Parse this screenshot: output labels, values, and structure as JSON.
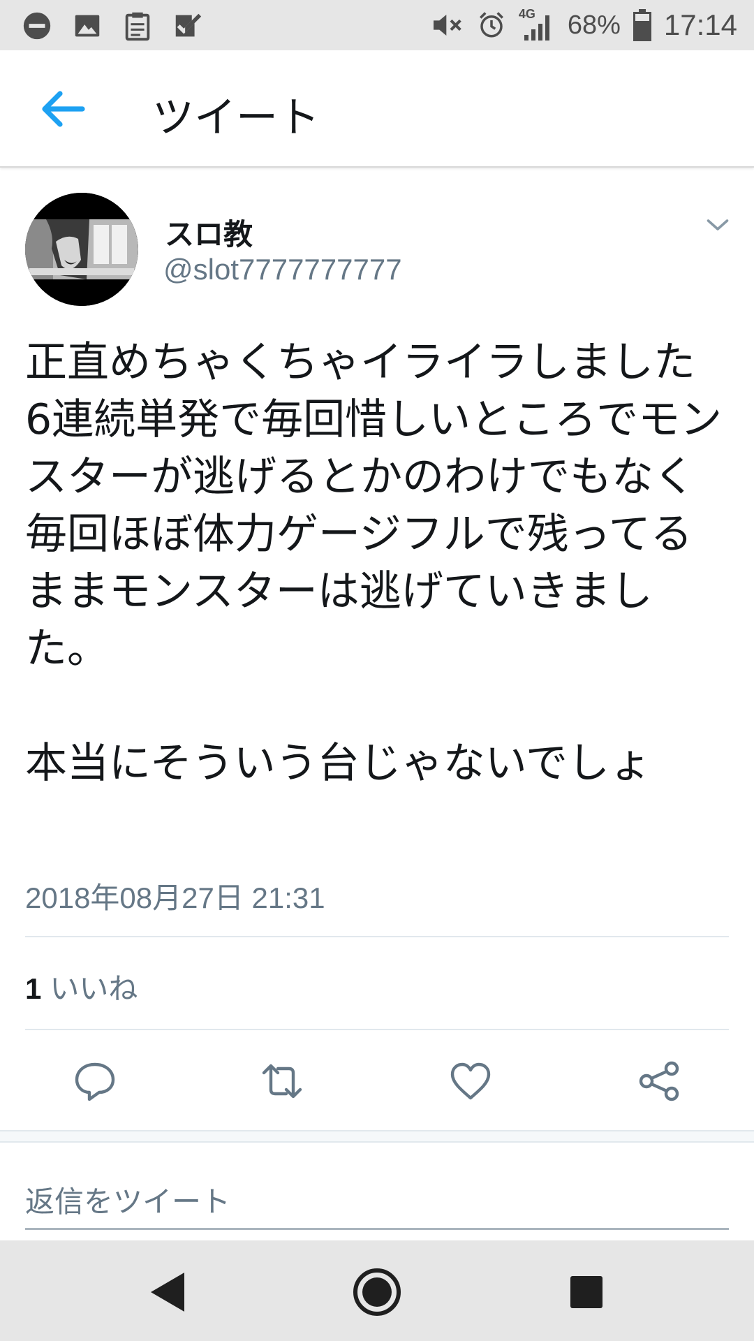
{
  "status_bar": {
    "battery": "68%",
    "network": "4G",
    "time": "17:14",
    "left_icons": [
      "do-not-disturb-icon",
      "image-icon",
      "clipboard-icon",
      "task-check-icon"
    ],
    "right_icons": [
      "mute-icon",
      "alarm-icon",
      "signal-icon",
      "battery-icon"
    ]
  },
  "app_bar": {
    "title": "ツイート",
    "back_icon": "arrow-left-icon",
    "accent": "#1da1f2"
  },
  "tweet": {
    "author_name": "スロ教",
    "author_handle": "@slot7777777777",
    "text": "正直めちゃくちゃイライラしました\n6連続単発で毎回惜しいところでモンスターが逃げるとかのわけでもなく毎回ほぼ体力ゲージフルで残ってるままモンスターは逃げていきました。\n\n本当にそういう台じゃないでしょ",
    "timestamp": "2018年08月27日 21:31",
    "likes_count": "1",
    "likes_label": "いいね"
  },
  "actions": [
    {
      "name": "reply",
      "icon": "reply-icon"
    },
    {
      "name": "retweet",
      "icon": "retweet-icon"
    },
    {
      "name": "like",
      "icon": "heart-icon"
    },
    {
      "name": "share",
      "icon": "share-icon"
    }
  ],
  "reply_box": {
    "placeholder": "返信をツイート",
    "value": ""
  },
  "nav_bar": {
    "buttons": [
      "back-triangle-icon",
      "home-circle-icon",
      "recents-square-icon"
    ]
  },
  "colors": {
    "text_primary": "#14171a",
    "text_secondary": "#657786",
    "divider": "#e1e8ed",
    "system_bar": "#e6e6e6"
  }
}
